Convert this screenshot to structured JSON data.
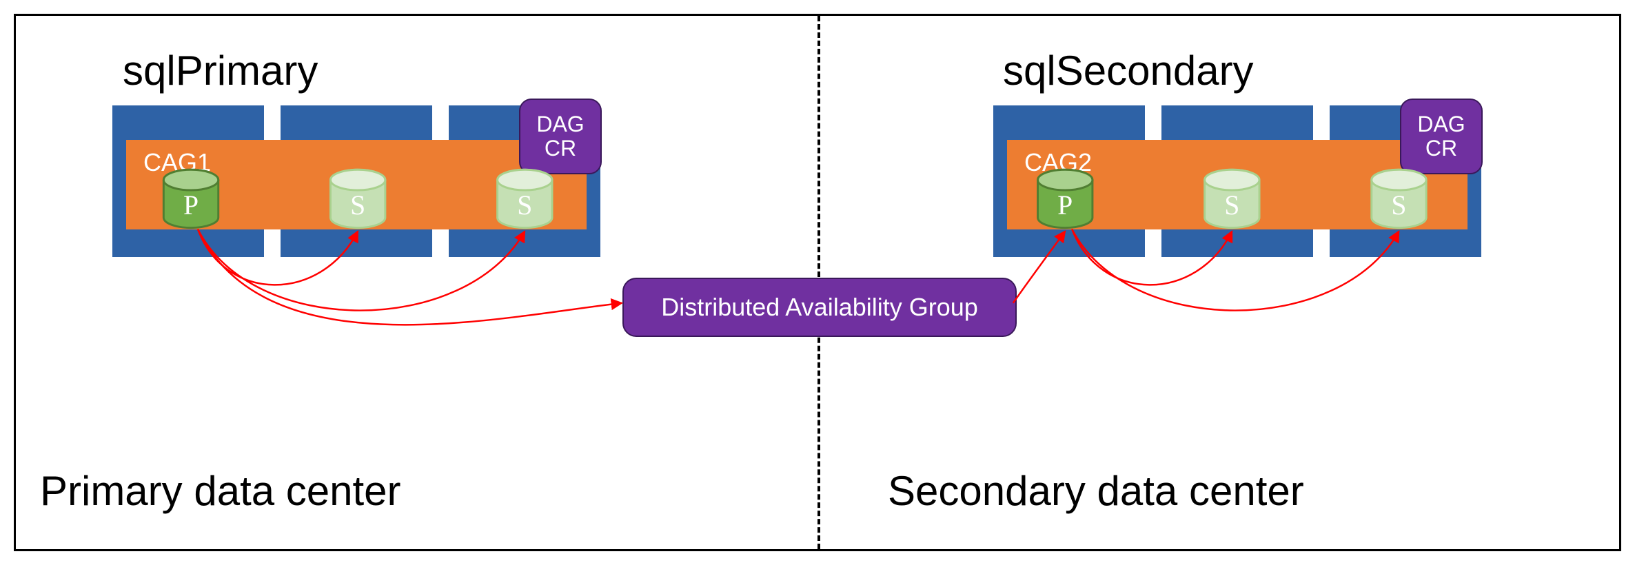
{
  "primary": {
    "dc_label": "Primary data center",
    "sql_label": "sqlPrimary",
    "cag_label": "CAG1",
    "dag_badge_line1": "DAG",
    "dag_badge_line2": "CR",
    "nodes": [
      "P",
      "S",
      "S"
    ]
  },
  "secondary": {
    "dc_label": "Secondary data center",
    "sql_label": "sqlSecondary",
    "cag_label": "CAG2",
    "dag_badge_line1": "DAG",
    "dag_badge_line2": "CR",
    "nodes": [
      "P",
      "S",
      "S"
    ]
  },
  "center_label": "Distributed Availability Group",
  "colors": {
    "node": "#2e62a6",
    "cag": "#ed7d31",
    "dag": "#7030a0",
    "primary_db": "#70ad47",
    "secondary_db": "#c5e0b4",
    "arrow": "#ff0000"
  }
}
